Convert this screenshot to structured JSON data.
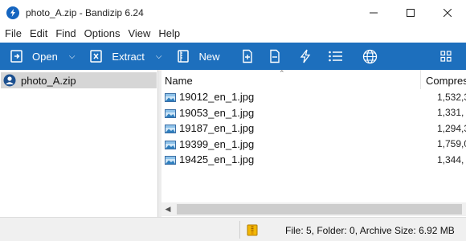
{
  "window": {
    "title": "photo_A.zip - Bandizip 6.24",
    "app_icon": "bandizip-icon"
  },
  "menu": [
    "File",
    "Edit",
    "Find",
    "Options",
    "View",
    "Help"
  ],
  "toolbar": {
    "open_label": "Open",
    "extract_label": "Extract",
    "new_label": "New",
    "accent": "#1d6fbd"
  },
  "tree": {
    "root_label": "photo_A.zip"
  },
  "columns": {
    "name": "Name",
    "compressed": "Compres"
  },
  "files": [
    {
      "name": "19012_en_1.jpg",
      "compressed": "1,532,3"
    },
    {
      "name": "19053_en_1.jpg",
      "compressed": "1,331,"
    },
    {
      "name": "19187_en_1.jpg",
      "compressed": "1,294,3"
    },
    {
      "name": "19399_en_1.jpg",
      "compressed": "1,759,0"
    },
    {
      "name": "19425_en_1.jpg",
      "compressed": "1,344,"
    }
  ],
  "status": {
    "text": "File: 5, Folder: 0, Archive Size: 6.92 MB"
  }
}
